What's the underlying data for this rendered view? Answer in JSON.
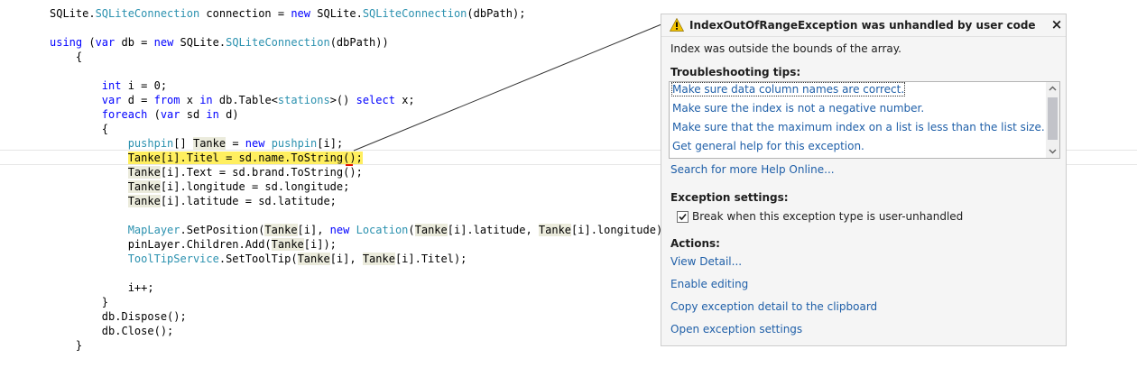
{
  "code": {
    "lines": [
      [
        "SQLite.",
        {
          "t": "SQLiteConnection",
          "c": "ty"
        },
        " connection = ",
        {
          "t": "new",
          "c": "kw"
        },
        " SQLite.",
        {
          "t": "SQLiteConnection",
          "c": "ty"
        },
        "(dbPath);"
      ],
      [],
      [
        {
          "t": "using",
          "c": "kw"
        },
        " (",
        {
          "t": "var",
          "c": "kw"
        },
        " db = ",
        {
          "t": "new",
          "c": "kw"
        },
        " SQLite.",
        {
          "t": "SQLiteConnection",
          "c": "ty"
        },
        "(dbPath))"
      ],
      [
        "    {"
      ],
      [],
      [
        "        ",
        {
          "t": "int",
          "c": "kw"
        },
        " i = 0;"
      ],
      [
        "        ",
        {
          "t": "var",
          "c": "kw"
        },
        " d = ",
        {
          "t": "from",
          "c": "kw"
        },
        " x ",
        {
          "t": "in",
          "c": "kw"
        },
        " db.Table<",
        {
          "t": "stations",
          "c": "ty"
        },
        ">() ",
        {
          "t": "select",
          "c": "kw"
        },
        " x;"
      ],
      [
        "        ",
        {
          "t": "foreach",
          "c": "kw"
        },
        " (",
        {
          "t": "var",
          "c": "kw"
        },
        " sd ",
        {
          "t": "in",
          "c": "kw"
        },
        " d)"
      ],
      [
        "        {"
      ],
      [
        "            ",
        {
          "t": "pushpin",
          "c": "ty"
        },
        "[] ",
        {
          "t": "Tanke",
          "c": "hl"
        },
        " = ",
        {
          "t": "new",
          "c": "kw"
        },
        " ",
        {
          "t": "pushpin",
          "c": "ty"
        },
        "[i];"
      ],
      [
        "            ",
        {
          "t": "Tanke[i].Titel = sd.name.ToString();",
          "c": "cur"
        }
      ],
      [
        "            ",
        {
          "t": "Tanke",
          "c": "hl"
        },
        "[i].Text = sd.brand.ToString();"
      ],
      [
        "            ",
        {
          "t": "Tanke",
          "c": "hl"
        },
        "[i].longitude = sd.longitude;"
      ],
      [
        "            ",
        {
          "t": "Tanke",
          "c": "hl"
        },
        "[i].latitude = sd.latitude;"
      ],
      [],
      [
        "            ",
        {
          "t": "MapLayer",
          "c": "ty"
        },
        ".SetPosition(",
        {
          "t": "Tanke",
          "c": "hl"
        },
        "[i], ",
        {
          "t": "new",
          "c": "kw"
        },
        " ",
        {
          "t": "Location",
          "c": "ty"
        },
        "(",
        {
          "t": "Tanke",
          "c": "hl"
        },
        "[i].latitude, ",
        {
          "t": "Tanke",
          "c": "hl"
        },
        "[i].longitude));"
      ],
      [
        "            pinLayer.Children.Add(",
        {
          "t": "Tanke",
          "c": "hl"
        },
        "[i]);"
      ],
      [
        "            ",
        {
          "t": "ToolTipService",
          "c": "ty"
        },
        ".SetToolTip(",
        {
          "t": "Tanke",
          "c": "hl"
        },
        "[i], ",
        {
          "t": "Tanke",
          "c": "hl"
        },
        "[i].Titel);"
      ],
      [],
      [
        "            i++;"
      ],
      [
        "        }"
      ],
      [
        "        db.Dispose();"
      ],
      [
        "        db.Close();"
      ],
      [
        "    }"
      ]
    ]
  },
  "colors": {
    "keyword": "#0000ff",
    "type": "#2b91af",
    "link": "#1f5fa8",
    "current_line_highlight": "#ffef5f",
    "reference_highlight": "#ebebdc",
    "warning_icon": "#f2c200"
  },
  "popup": {
    "icon": "warning-icon",
    "title": "IndexOutOfRangeException was unhandled by user code",
    "close_icon": "×",
    "message": "Index was outside the bounds of the array.",
    "troubleshooting": {
      "label": "Troubleshooting tips:",
      "tips": [
        "Make sure data column names are correct.",
        "Make sure the index is not a negative number.",
        "Make sure that the maximum index on a list is less than the list size.",
        "Get general help for this exception."
      ],
      "search_link": "Search for more Help Online..."
    },
    "exception_settings": {
      "label": "Exception settings:",
      "checkbox_label": "Break when this exception type is user-unhandled",
      "checked": true
    },
    "actions": {
      "label": "Actions:",
      "links": [
        "View Detail...",
        "Enable editing",
        "Copy exception detail to the clipboard",
        "Open exception settings"
      ]
    }
  }
}
